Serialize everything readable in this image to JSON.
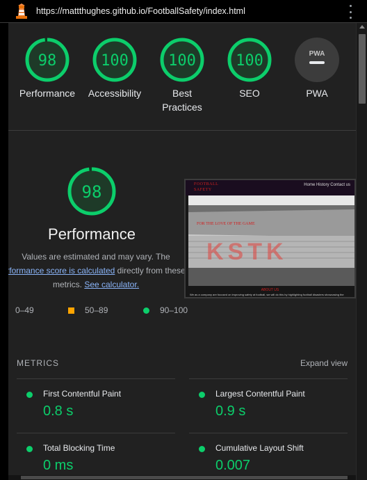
{
  "colors": {
    "pass": "#0cce6b",
    "average": "#ffa400",
    "link": "#8ab4f8",
    "background": "#212121"
  },
  "browser": {
    "url": "https://mattthughes.github.io/FootballSafety/index.html",
    "logo_icon": "lighthouse-icon",
    "menu_icon": "more-vert-icon"
  },
  "summary": [
    {
      "label": "Performance",
      "score": 98
    },
    {
      "label": "Accessibility",
      "score": 100
    },
    {
      "label": "Best",
      "label2": "Practices",
      "score": 100
    },
    {
      "label": "SEO",
      "score": 100
    },
    {
      "label": "PWA",
      "badge": "PWA",
      "icon": "pwa-icon"
    }
  ],
  "performance": {
    "score": 98,
    "title": "Performance",
    "desc_1": "Values are estimated and may vary. The",
    "desc_link_1": "rformance score is calculated",
    "desc_2": " directly from these",
    "desc_3": "metrics. ",
    "desc_link_2": "See calculator."
  },
  "legend": [
    {
      "range": "0–49"
    },
    {
      "range": "50–89"
    },
    {
      "range": "90–100"
    }
  ],
  "screenshot": {
    "logo_line1": "FOOTBALL",
    "logo_line2": "SAFETY",
    "nav": "Home  History  Contact us",
    "tagline": "FOR THE LOVE OF THE GAME",
    "mosaic_text": "KSTK",
    "about": "ABOUT US",
    "body_text": "We as a company are focused on improving safety at football, we will do this by highlighting football disasters showcasing the"
  },
  "metrics": {
    "header": "METRICS",
    "expand": "Expand view",
    "items": [
      {
        "name": "First Contentful Paint",
        "value": "0.8 s"
      },
      {
        "name": "Largest Contentful Paint",
        "value": "0.9 s"
      },
      {
        "name": "Total Blocking Time",
        "value": "0 ms"
      },
      {
        "name": "Cumulative Layout Shift",
        "value": "0.007"
      }
    ]
  }
}
